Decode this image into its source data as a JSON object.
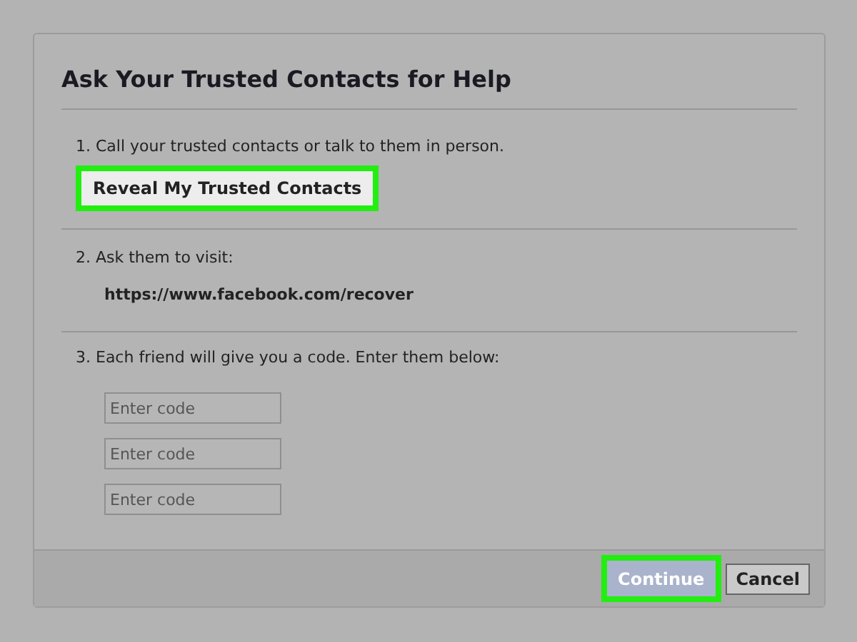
{
  "dialog": {
    "title": "Ask Your Trusted Contacts for Help"
  },
  "steps": [
    {
      "kind": "button",
      "text": "1. Call your trusted contacts or talk to them in person.",
      "button": {
        "label": "Reveal My Trusted Contacts",
        "highlighted": true
      }
    },
    {
      "kind": "link",
      "text": "2. Ask them to visit:",
      "url": "https://www.facebook.com/recover"
    },
    {
      "kind": "codes",
      "text": "3. Each friend will give you a code. Enter them below:",
      "fields": [
        {
          "placeholder": "Enter code"
        },
        {
          "placeholder": "Enter code"
        },
        {
          "placeholder": "Enter code"
        }
      ]
    }
  ],
  "footer": {
    "buttons": [
      {
        "label": "Continue",
        "kind": "primary",
        "highlighted": true
      },
      {
        "label": "Cancel",
        "kind": "secondary",
        "highlighted": false
      }
    ]
  }
}
